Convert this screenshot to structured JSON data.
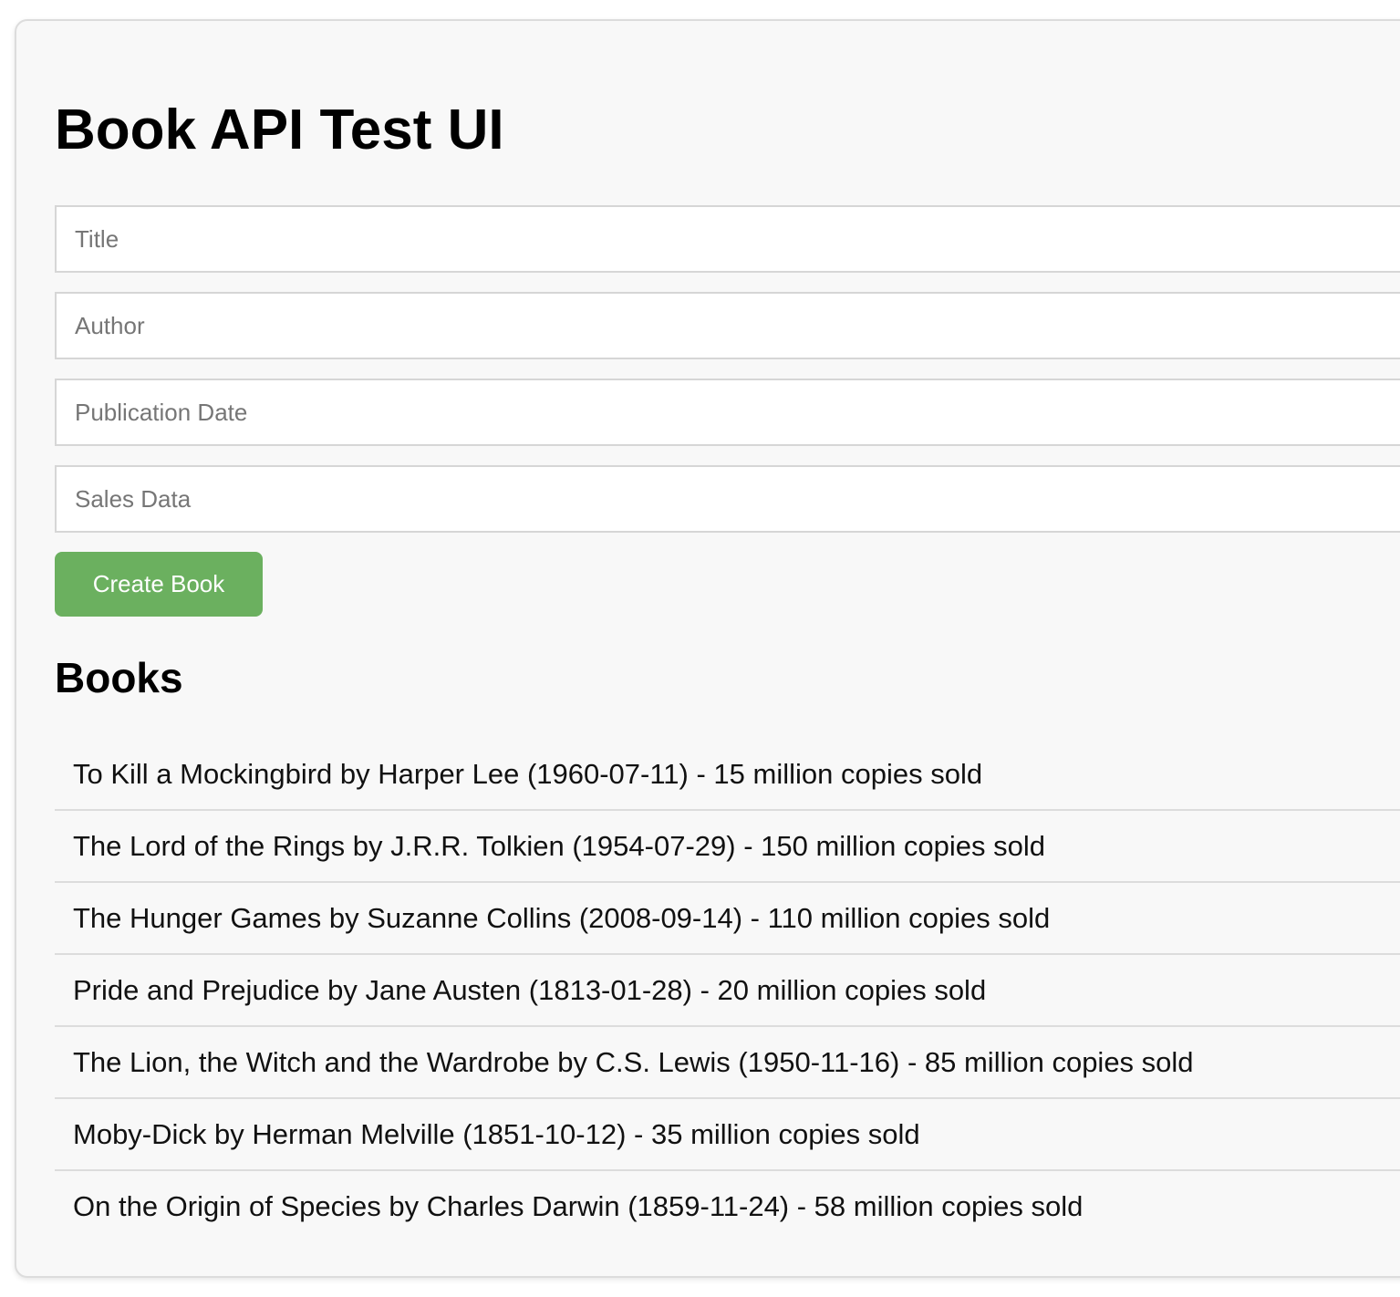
{
  "page": {
    "title": "Book API Test UI"
  },
  "form": {
    "title_placeholder": "Title",
    "author_placeholder": "Author",
    "date_placeholder": "Publication Date",
    "sales_placeholder": "Sales Data",
    "title_value": "",
    "author_value": "",
    "date_value": "",
    "sales_value": "",
    "create_label": "Create Book"
  },
  "books": {
    "heading": "Books",
    "items": [
      "To Kill a Mockingbird by Harper Lee (1960-07-11) - 15 million copies sold",
      "The Lord of the Rings by J.R.R. Tolkien (1954-07-29) - 150 million copies sold",
      "The Hunger Games by Suzanne Collins (2008-09-14) - 110 million copies sold",
      "Pride and Prejudice by Jane Austen (1813-01-28) - 20 million copies sold",
      "The Lion, the Witch and the Wardrobe by C.S. Lewis (1950-11-16) - 85 million copies sold",
      "Moby-Dick by Herman Melville (1851-10-12) - 35 million copies sold",
      "On the Origin of Species by Charles Darwin (1859-11-24) - 58 million copies sold"
    ]
  },
  "colors": {
    "button_background": "#6bb05f",
    "button_text": "#ffffff",
    "panel_background": "#f8f8f8",
    "border": "#dcdcdc"
  }
}
